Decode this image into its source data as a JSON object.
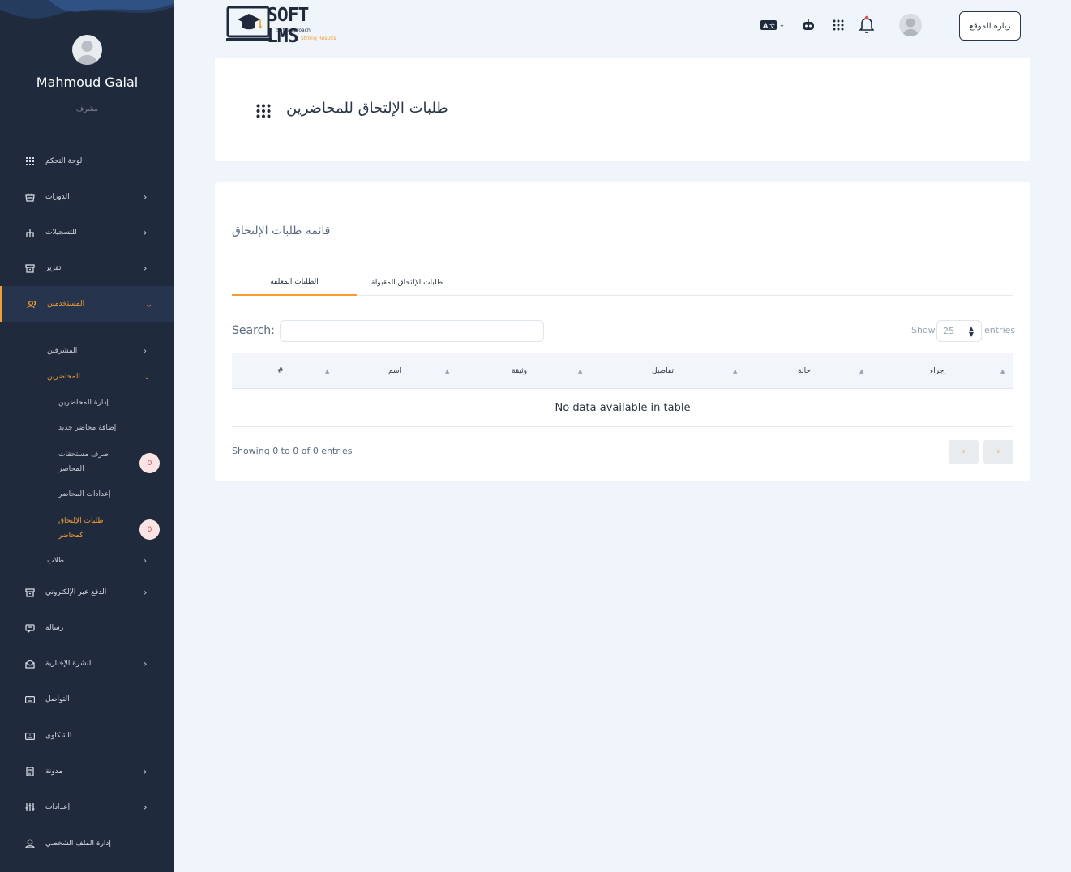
{
  "sidebar": {
    "user_name": "Mahmoud Galal",
    "user_role": "مشرف",
    "items": [
      {
        "label": "لوحة التحكم",
        "icon": "grid-icon",
        "chevron": false
      },
      {
        "label": "الدورات",
        "icon": "basket-icon",
        "chevron": true
      },
      {
        "label": "للتسجيلات",
        "icon": "sitemap-icon",
        "chevron": true
      },
      {
        "label": "تقرير",
        "icon": "archive-icon",
        "chevron": true
      },
      {
        "label": "المستخدمين",
        "icon": "users-icon",
        "chevron": true,
        "active": true
      }
    ],
    "sub_items": {
      "supervisors": "المشرفين",
      "lecturers": "المحاضرين",
      "manage_lecturers": "إدارة المحاضرين",
      "add_lecturer": "إضافة محاضر جديد",
      "lecturer_payouts": "صرف مستحقات المحاضر",
      "lecturer_settings": "إعدادات المحاضر",
      "join_requests": "طلبات الإلتحاق كمحاضر",
      "students": "طلاب",
      "payouts_badge": "0",
      "requests_badge": "0"
    },
    "items_bottom": [
      {
        "label": "الدفع عبر الإلكتروني",
        "icon": "archive-icon",
        "chevron": true
      },
      {
        "label": "رسالة",
        "icon": "message-icon",
        "chevron": false
      },
      {
        "label": "النشرة الإخبارية",
        "icon": "mail-open-icon",
        "chevron": true
      },
      {
        "label": "التواصل",
        "icon": "keyboard-icon",
        "chevron": false
      },
      {
        "label": "الشكاوى",
        "icon": "keyboard-icon",
        "chevron": false
      },
      {
        "label": "مدونة",
        "icon": "notebook-icon",
        "chevron": true
      },
      {
        "label": "إعدادات",
        "icon": "sliders-icon",
        "chevron": true
      },
      {
        "label": "إدارة الملف الشخصي",
        "icon": "user-icon",
        "chevron": false
      }
    ]
  },
  "header": {
    "logo_text": "SOFT LMS",
    "logo_tagline_1": "Soft approach",
    "logo_tagline_2": "Strong Results",
    "visit_site": "زيارة الموقع"
  },
  "page": {
    "title": "طلبات الإلتحاق للمحاضرين",
    "list_title": "قائمة طلبات الإلتحاق",
    "tabs": [
      "الطلبات المعلقة",
      "طلبات الإلتحاق المقبولة"
    ],
    "search_label": "Search:",
    "search_placeholder": "",
    "show_label": "Show",
    "show_value": "25",
    "entries_label": "entries",
    "columns": [
      "#",
      "اسم",
      "وثيقة",
      "تفاصيل",
      "حالة",
      "إجراء"
    ],
    "empty_text": "No data available in table",
    "info_text": "Showing 0 to 0 of 0 entries",
    "prev": "‹",
    "next": "›"
  },
  "colors": {
    "sidebar_bg": "#1f2b3d",
    "accent": "#f59e2b",
    "page_bg": "#f0f5fb"
  }
}
